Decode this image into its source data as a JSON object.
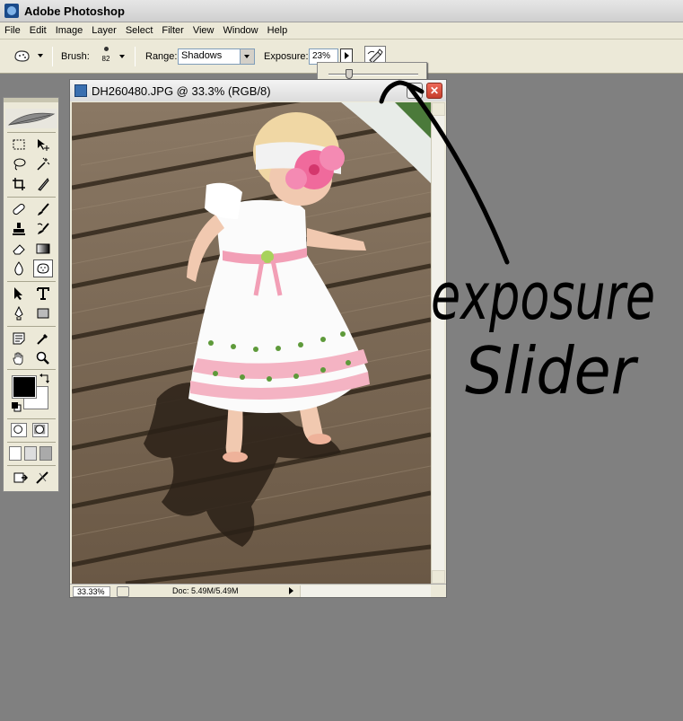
{
  "window": {
    "title": "Adobe Photoshop",
    "icon": "photoshop-app-icon"
  },
  "menu": [
    "File",
    "Edit",
    "Image",
    "Layer",
    "Select",
    "Filter",
    "View",
    "Window",
    "Help"
  ],
  "options_bar": {
    "brush_label": "Brush:",
    "brush_size": "82",
    "range_label": "Range:",
    "range_value": "Shadows",
    "exposure_label": "Exposure:",
    "exposure_value": "23%",
    "exposure_fraction": 0.23
  },
  "document": {
    "title": "DH260480.JPG @ 33.3% (RGB/8)",
    "zoom": "33.33%",
    "doc_size": "Doc: 5.49M/5.49M"
  },
  "colors": {
    "foreground": "#000000",
    "background": "#ffffff",
    "annotation_ink": "#000000"
  },
  "annotation": {
    "line1": "exposure",
    "line2": "Slider"
  }
}
